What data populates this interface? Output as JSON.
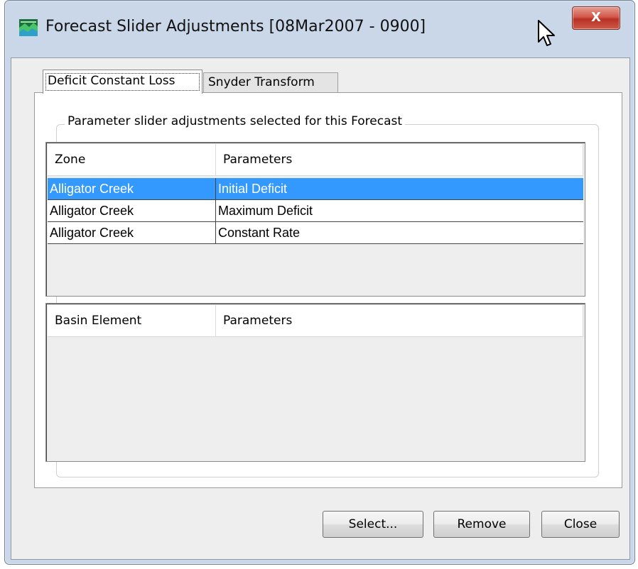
{
  "window": {
    "title": "Forecast Slider Adjustments [08Mar2007 - 0900]",
    "close_glyph": "X",
    "app_icon": "landscape-app-icon"
  },
  "tabs": [
    {
      "label": "Deficit Constant Loss",
      "active": true
    },
    {
      "label": "Snyder Transform",
      "active": false
    }
  ],
  "group": {
    "legend": "Parameter slider adjustments selected for this Forecast"
  },
  "zone_table": {
    "columns": [
      "Zone",
      "Parameters"
    ],
    "rows": [
      {
        "zone": "Alligator Creek",
        "parameter": "Initial Deficit",
        "selected": true
      },
      {
        "zone": "Alligator Creek",
        "parameter": "Maximum Deficit",
        "selected": false
      },
      {
        "zone": "Alligator Creek",
        "parameter": "Constant Rate",
        "selected": false
      }
    ]
  },
  "basin_table": {
    "columns": [
      "Basin Element",
      "Parameters"
    ],
    "rows": []
  },
  "buttons": {
    "select": "Select...",
    "remove": "Remove",
    "close": "Close"
  },
  "colors": {
    "selection": "#3399ff",
    "titlebar": "#c9d7e8",
    "close_button": "#c8473a"
  }
}
